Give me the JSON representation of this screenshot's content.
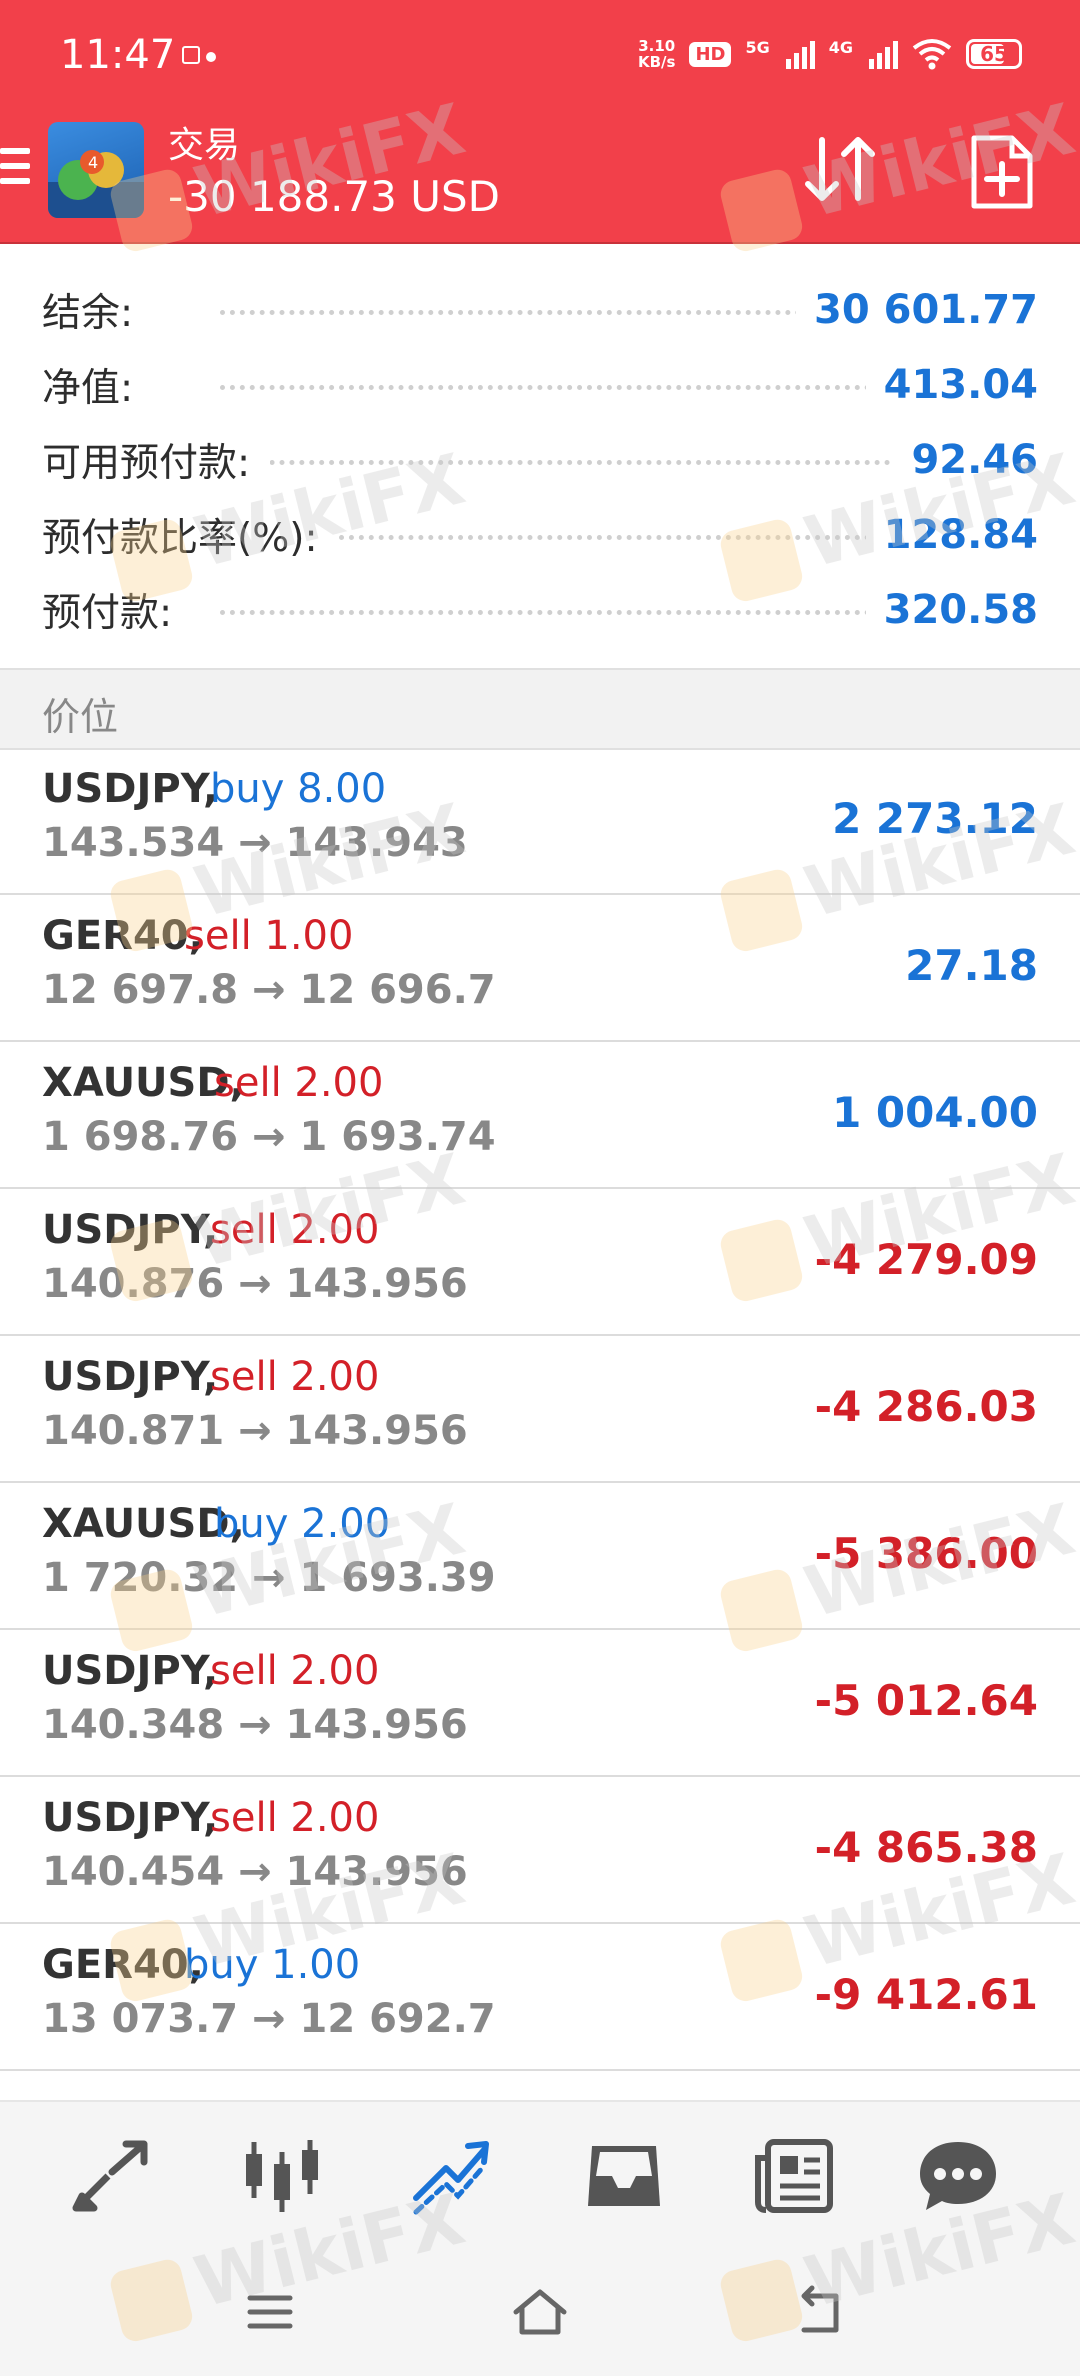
{
  "status_bar": {
    "time": "11:47",
    "speed_value": "3.10",
    "speed_unit": "KB/s",
    "hd_label": "HD",
    "net1": "5G",
    "net2": "4G",
    "battery": "65"
  },
  "header": {
    "title": "交易",
    "balance_display": "-30 188.73 USD"
  },
  "summary": [
    {
      "label": "结余:",
      "value": "30 601.77"
    },
    {
      "label": "净值:",
      "value": "413.04"
    },
    {
      "label": "可用预付款:",
      "value": "92.46"
    },
    {
      "label": "预付款比率(%):",
      "value": "128.84"
    },
    {
      "label": "预付款:",
      "value": "320.58"
    }
  ],
  "section_title": "价位",
  "positions": [
    {
      "symbol": "USDJPY,",
      "side": "buy 8.00",
      "prices": "143.534 → 143.943",
      "profit": "2 273.12"
    },
    {
      "symbol": "GER40,",
      "side": "sell 1.00",
      "prices": "12 697.8 → 12 696.7",
      "profit": "27.18"
    },
    {
      "symbol": "XAUUSD,",
      "side": "sell 2.00",
      "prices": "1 698.76 → 1 693.74",
      "profit": "1 004.00"
    },
    {
      "symbol": "USDJPY,",
      "side": "sell 2.00",
      "prices": "140.876 → 143.956",
      "profit": "-4 279.09"
    },
    {
      "symbol": "USDJPY,",
      "side": "sell 2.00",
      "prices": "140.871 → 143.956",
      "profit": "-4 286.03"
    },
    {
      "symbol": "XAUUSD,",
      "side": "buy 2.00",
      "prices": "1 720.32 → 1 693.39",
      "profit": "-5 386.00"
    },
    {
      "symbol": "USDJPY,",
      "side": "sell 2.00",
      "prices": "140.348 → 143.956",
      "profit": "-5 012.64"
    },
    {
      "symbol": "USDJPY,",
      "side": "sell 2.00",
      "prices": "140.454 → 143.956",
      "profit": "-4 865.38"
    },
    {
      "symbol": "GER40,",
      "side": "buy 1.00",
      "prices": "13 073.7 → 12 692.7",
      "profit": "-9 412.61"
    }
  ],
  "watermark": "WikiFX",
  "colors": {
    "header_bg": "#f2404a",
    "value_blue": "#1a73d6",
    "loss_red": "#d32028"
  },
  "nav_icons": [
    "quotes-icon",
    "chart-icon",
    "trade-icon",
    "history-icon",
    "news-icon",
    "chat-icon"
  ],
  "active_nav": "trade-icon"
}
